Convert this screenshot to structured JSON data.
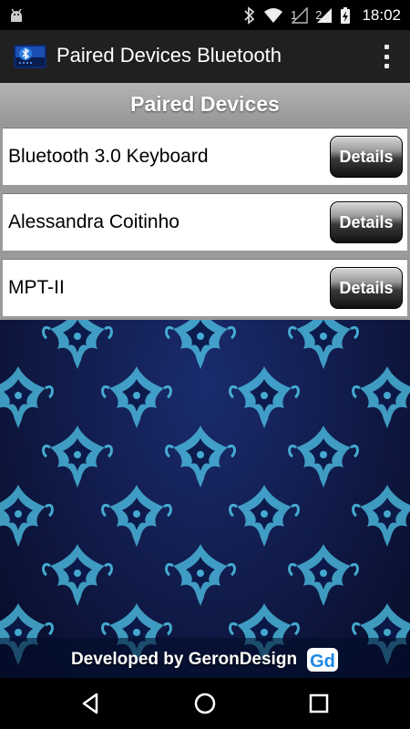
{
  "status_bar": {
    "sim1_label": "1",
    "sim2_label": "2",
    "time": "18:02",
    "icons": [
      "android-debug-icon",
      "bluetooth-icon",
      "wifi-icon",
      "signal-icon",
      "battery-charging-icon"
    ]
  },
  "app_bar": {
    "title": "Paired Devices Bluetooth",
    "icon": "app-bluetooth-icon",
    "menu_icon": "overflow-menu-icon"
  },
  "section": {
    "title": "Paired Devices"
  },
  "devices": [
    {
      "name": "Bluetooth 3.0 Keyboard",
      "button_label": "Details"
    },
    {
      "name": "Alessandra Coitinho",
      "button_label": "Details"
    },
    {
      "name": "MPT-II",
      "button_label": "Details"
    }
  ],
  "footer": {
    "text": "Developed by GeronDesign",
    "logo_text": "Gd"
  },
  "nav": {
    "back_icon": "back-icon",
    "home_icon": "home-icon",
    "recents_icon": "recents-icon"
  },
  "colors": {
    "action_bar": "#202020",
    "header_strip": "#a5a5a5",
    "background_dark": "#0a1135",
    "pattern_cyan": "#4fc3e8",
    "logo_blue": "#1e88e5"
  }
}
